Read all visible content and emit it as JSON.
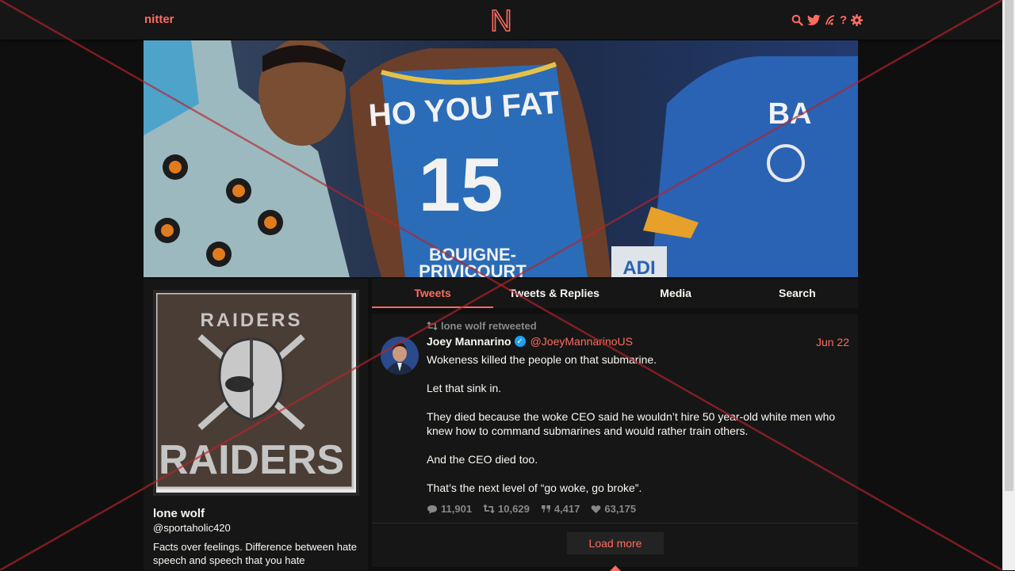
{
  "nav": {
    "brand": "nitter",
    "logo_letter": "N",
    "icons": [
      "search-icon",
      "twitter-icon",
      "rss-icon",
      "help-icon",
      "settings-icon"
    ],
    "help_glyph": "?",
    "accent": "#ff6c60"
  },
  "banner": {
    "jersey_text": "HO YOU FAT",
    "jersey_number": "15",
    "sponsor_line1": "BOUIGNE-",
    "sponsor_line2": "PRIVICOURT",
    "right_jersey_text": "BA",
    "side_text": "ADI"
  },
  "profile": {
    "avatar_text_top": "RAIDERS",
    "avatar_text_bottom": "RAIDERS",
    "name": "lone wolf",
    "handle": "@sportaholic420",
    "bio": "Facts over feelings. Difference between hate speech and speech that you hate"
  },
  "tabs": [
    "Tweets",
    "Tweets & Replies",
    "Media",
    "Search"
  ],
  "tweet": {
    "retweet_label": "lone wolf retweeted",
    "name": "Joey Mannarino",
    "handle": "@JoeyMannarinoUS",
    "date": "Jun 22",
    "paragraphs": [
      "Wokeness killed the people on that submarine.",
      "Let that sink in.",
      "They died because the woke CEO said he wouldn’t hire 50 year-old white men who knew how to command submarines and would rather train others.",
      "And the CEO died too.",
      "That’s the next level of “go woke, go broke”."
    ],
    "replies": "11,901",
    "retweets": "10,629",
    "quotes": "4,417",
    "likes": "63,175"
  },
  "load_more": "Load more"
}
